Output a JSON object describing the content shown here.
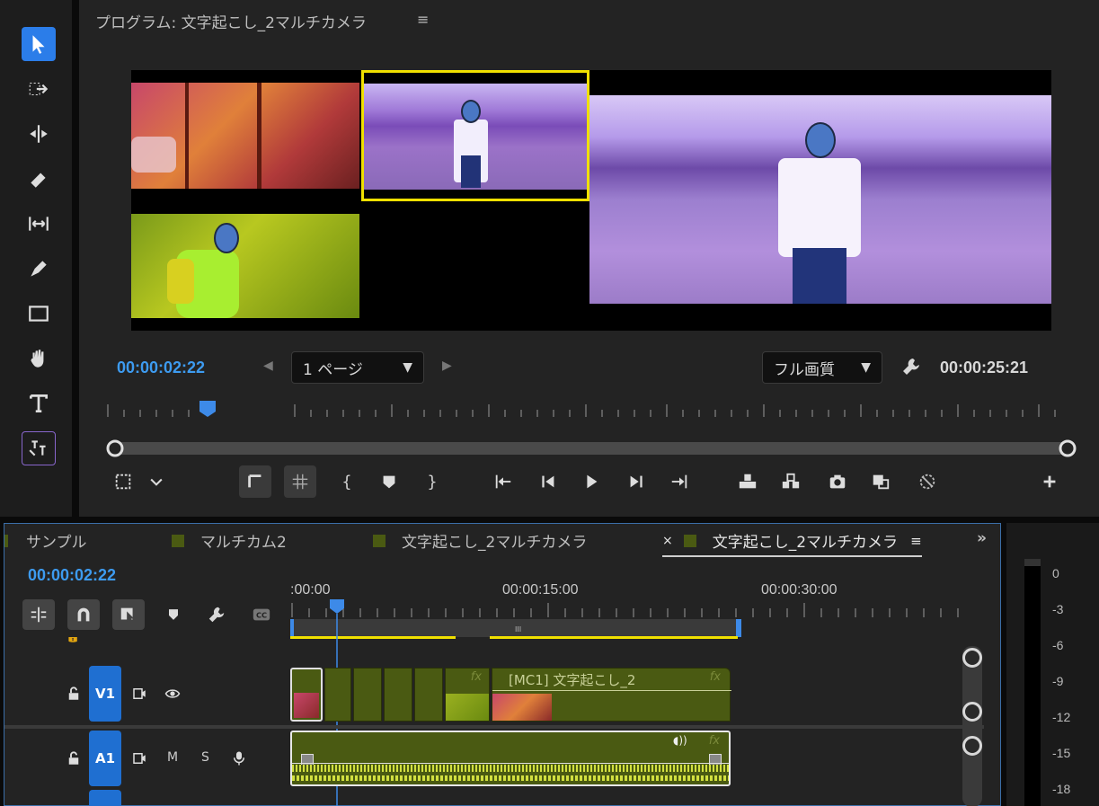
{
  "program": {
    "title": "プログラム: 文字起こし_2マルチカメラ",
    "menu_icon": "≡",
    "current_timecode": "00:00:02:22",
    "page_select": "1 ページ",
    "quality_select": "フル画質",
    "duration_timecode": "00:00:25:21"
  },
  "tools": [
    "selection-tool",
    "track-select-tool",
    "ripple-edit-tool",
    "razor-tool",
    "slip-tool",
    "pen-tool",
    "rectangle-tool",
    "hand-tool",
    "type-tool",
    "caption-tool"
  ],
  "timeline": {
    "tabs": [
      {
        "label": "サンプル",
        "active": false
      },
      {
        "label": "マルチカム2",
        "active": false
      },
      {
        "label": "文字起こし_2マルチカメラ",
        "active": false
      },
      {
        "label": "文字起こし_2マルチカメラ",
        "active": true
      }
    ],
    "tab_close": "×",
    "tab_menu": "≡",
    "overflow": "»",
    "current_timecode": "00:00:02:22",
    "ruler_labels": [
      ":00:00",
      "00:00:15:00",
      "00:00:30:00"
    ],
    "tracks": {
      "v1_label": "V1",
      "a1_label": "A1",
      "mute_label": "M",
      "solo_label": "S"
    },
    "clip_label": "[MC1] 文字起こし_2",
    "fx_label": "fx"
  },
  "meter": {
    "db_labels": [
      "0",
      "-3",
      "-6",
      "-9",
      "-12",
      "-15",
      "-18"
    ]
  },
  "colors": {
    "accent": "#2b7de9",
    "timecode": "#3d9bf0",
    "clip_green": "#4a5a12",
    "in_out_yellow": "#f0e000"
  }
}
